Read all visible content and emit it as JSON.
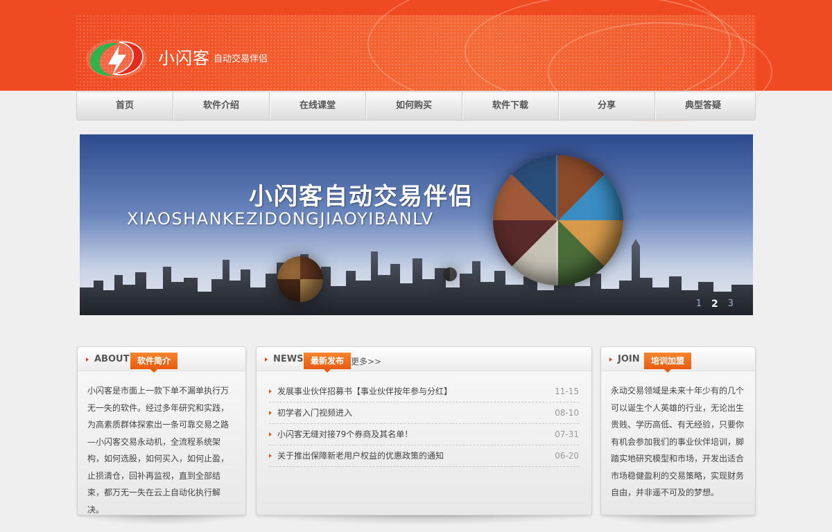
{
  "brand": {
    "name": "小闪客",
    "tagline": "自动交易伴侣"
  },
  "nav": {
    "items": [
      "首页",
      "软件介绍",
      "在线课堂",
      "如何购买",
      "软件下载",
      "分享",
      "典型答疑"
    ]
  },
  "banner": {
    "title": "小闪客自动交易伴侣",
    "subtitle": "XIAOSHANKEZIDONGJIAOYIBANLV",
    "pager": [
      "1",
      "2",
      "3"
    ],
    "active_page": "2"
  },
  "about": {
    "en": "ABOUT",
    "tag": "软件简介",
    "text": "小闪客是市面上一款下单不漏单执行万无一失的软件。经过多年研究和实践，为高素质群体探索出一条可靠交易之路—小闪客交易永动机，全流程系统架构，如何选股，如何买入，如何止盈，止损清仓，回补再监视，直到全部结束，都万无一失在云上自动化执行解决。"
  },
  "news": {
    "en": "NEWS",
    "tag": "最新发布",
    "more": "更多>>",
    "items": [
      {
        "title": "发展事业伙伴招募书【事业伙伴按年参与分红】",
        "date": "11-15"
      },
      {
        "title": "初学者入门视频进入",
        "date": "08-10"
      },
      {
        "title": "小闪客无缝对接79个券商及其名单！",
        "date": "07-31"
      },
      {
        "title": "关于推出保障新老用户权益的优惠政策的通知",
        "date": "06-20"
      }
    ]
  },
  "join": {
    "en": "JOIN",
    "tag": "培训加盟",
    "text": "永动交易领域是未来十年少有的几个可以诞生个人英雄的行业，无论出生贵贱、学历高低、有无经验，只要你有机会参加我们的事业伙伴培训，脚踏实地研究模型和市场，开发出适合市场稳健盈利的交易策略，实现财务自由，并非遥不可及的梦想。"
  },
  "colors": {
    "header": "#f04a22",
    "accent": "#e85a10"
  }
}
